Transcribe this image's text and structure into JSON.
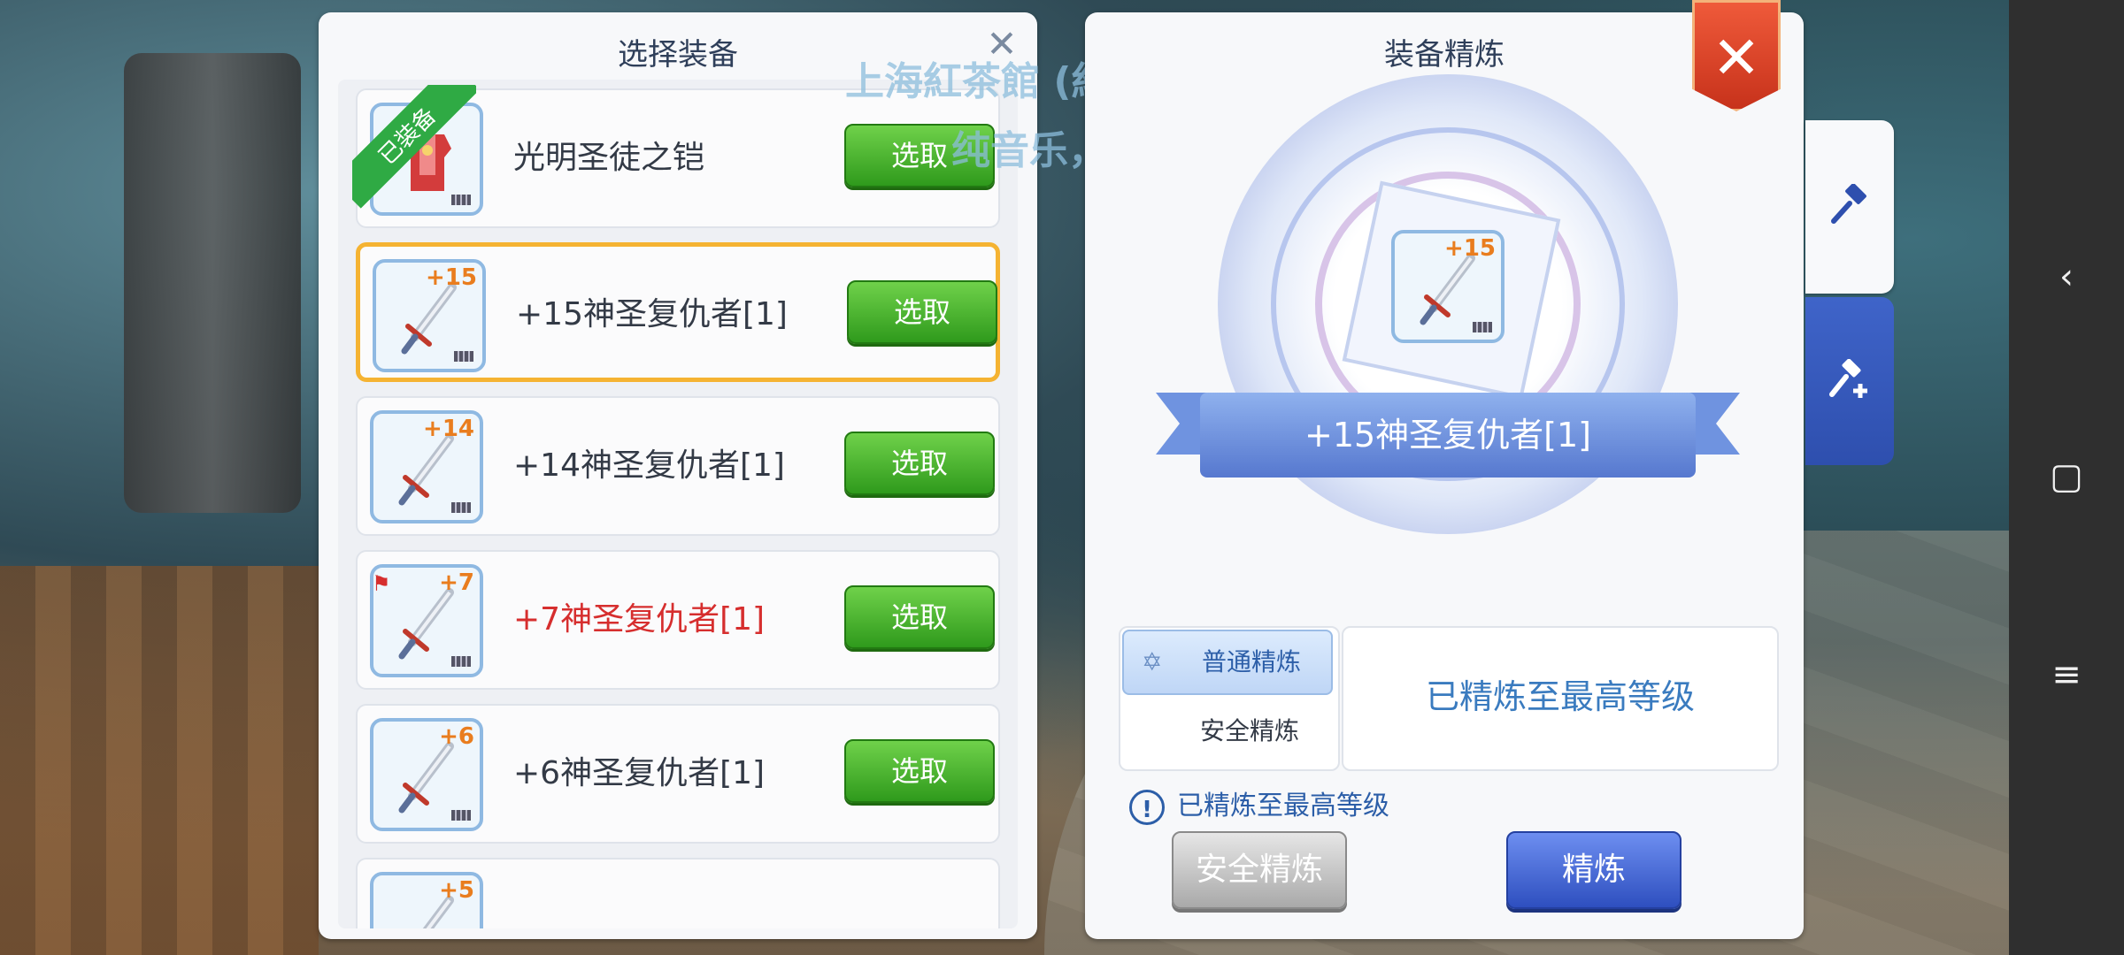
{
  "overlay": {
    "line1": "上海紅茶館 (紅魔鄉) - 天門",
    "line2": "纯音乐，请欣赏"
  },
  "left_panel": {
    "title": "选择装备",
    "equipped_badge": "已装备",
    "items": [
      {
        "name": "光明圣徒之铠",
        "plus": "",
        "equipped": true,
        "red": false,
        "icon": "armor-icon",
        "button": "选取"
      },
      {
        "name": "+15神圣复仇者[1]",
        "plus": "+15",
        "equipped": false,
        "red": false,
        "icon": "sword-icon",
        "button": "选取",
        "selected": true
      },
      {
        "name": "+14神圣复仇者[1]",
        "plus": "+14",
        "equipped": false,
        "red": false,
        "icon": "sword-icon",
        "button": "选取"
      },
      {
        "name": "+7神圣复仇者[1]",
        "plus": "+7",
        "equipped": false,
        "red": true,
        "icon": "sword-icon",
        "button": "选取"
      },
      {
        "name": "+6神圣复仇者[1]",
        "plus": "+6",
        "equipped": false,
        "red": false,
        "icon": "sword-icon",
        "button": "选取"
      },
      {
        "name": "",
        "plus": "+5",
        "equipped": false,
        "red": false,
        "icon": "sword-icon",
        "button": ""
      }
    ]
  },
  "right_panel": {
    "title": "装备精炼",
    "center_item": {
      "name": "+15神圣复仇者[1]",
      "plus": "+15"
    },
    "modes": {
      "normal": "普通精炼",
      "safe": "安全精炼"
    },
    "status_box": "已精炼至最高等级",
    "notice": "已精炼至最高等级",
    "buttons": {
      "safe": "安全精炼",
      "refine": "精炼"
    }
  },
  "colors": {
    "accent_blue": "#2e4fbf",
    "select_green": "#2f9a1c",
    "selected_border": "#f5b332",
    "warning_red": "#d62e2e"
  }
}
